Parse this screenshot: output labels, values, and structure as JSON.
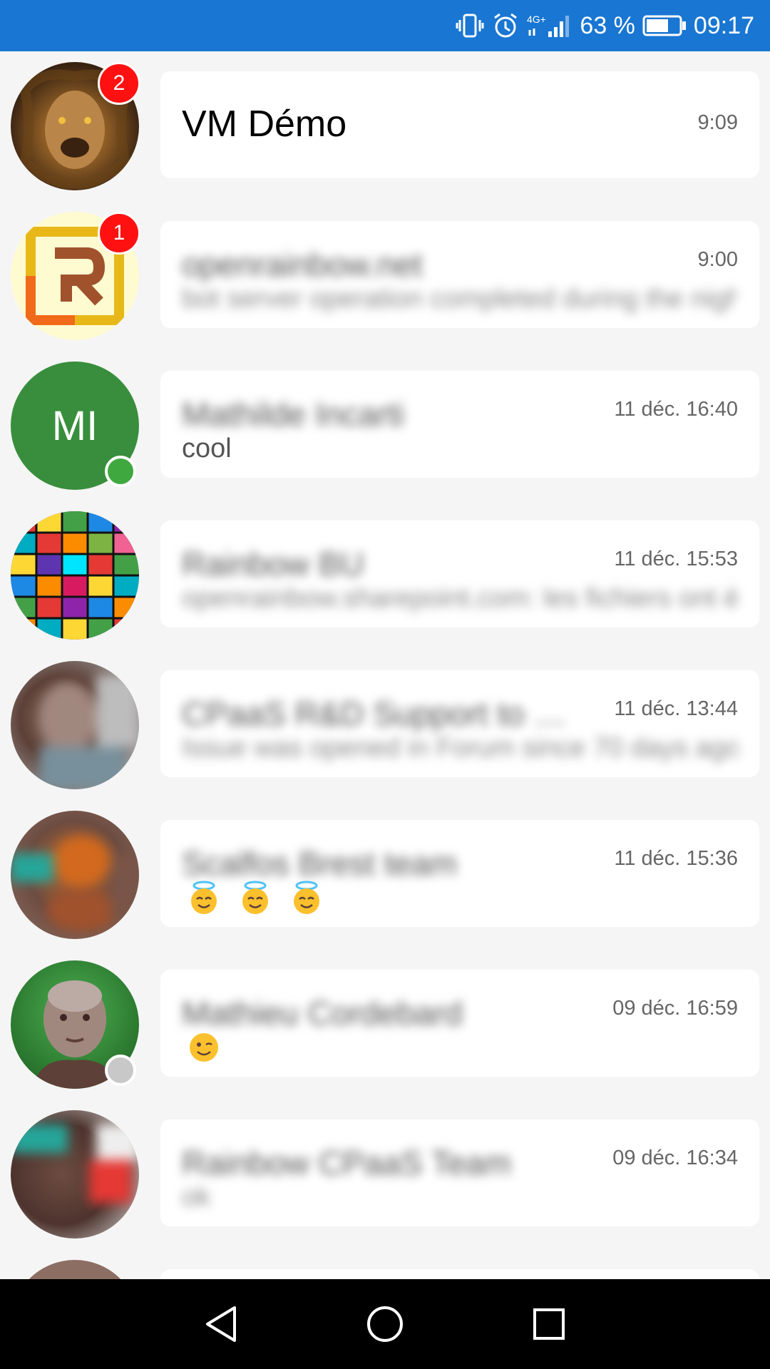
{
  "status_bar": {
    "network": "4G+",
    "battery_percent": "63 %",
    "time": "09:17",
    "icons": [
      "vibrate-icon",
      "alarm-icon",
      "signal-icon",
      "battery-icon"
    ]
  },
  "conversations": [
    {
      "name": "VM Démo",
      "time": "9:09",
      "message": "",
      "unread": "2",
      "avatar": "lion-photo",
      "presence": ""
    },
    {
      "name": "openrainbow.net",
      "time": "9:00",
      "message": "bot server operation completed during the night",
      "unread": "1",
      "avatar": "rainbow-logo",
      "presence": ""
    },
    {
      "name": "Mathilde Incarti",
      "time": "11 déc. 16:40",
      "message": "cool",
      "unread": "",
      "avatar_initials": "MI",
      "avatar_color": "#388e3c",
      "presence": "online"
    },
    {
      "name": "Rainbow BU",
      "time": "11 déc. 15:53",
      "message": "openrainbow.sharepoint.com: les fichiers ont été",
      "unread": "",
      "avatar": "color-cubes",
      "presence": ""
    },
    {
      "name": "CPaaS R&D Support to …",
      "time": "11 déc. 13:44",
      "message": "Issue was opened in Forum since 70 days ago",
      "unread": "",
      "avatar": "person-photo",
      "presence": ""
    },
    {
      "name": "Scalfos Brest team",
      "time": "11 déc. 15:36",
      "message": "😇 😇 😇",
      "unread": "",
      "avatar": "group-photo",
      "presence": ""
    },
    {
      "name": "Mathieu Cordebard",
      "time": "09 déc. 16:59",
      "message": "😉",
      "unread": "",
      "avatar": "man-portrait",
      "presence": "offline"
    },
    {
      "name": "Rainbow CPaaS Team",
      "time": "09 déc. 16:34",
      "message": "ok",
      "unread": "",
      "avatar": "group-photo",
      "presence": ""
    }
  ],
  "nav": {
    "icons": [
      "back-icon",
      "home-icon",
      "recents-icon"
    ]
  },
  "colors": {
    "status_bar": "#1976d2",
    "badge": "#ff1111",
    "online": "#3fa83f",
    "offline": "#c8c8c8"
  }
}
